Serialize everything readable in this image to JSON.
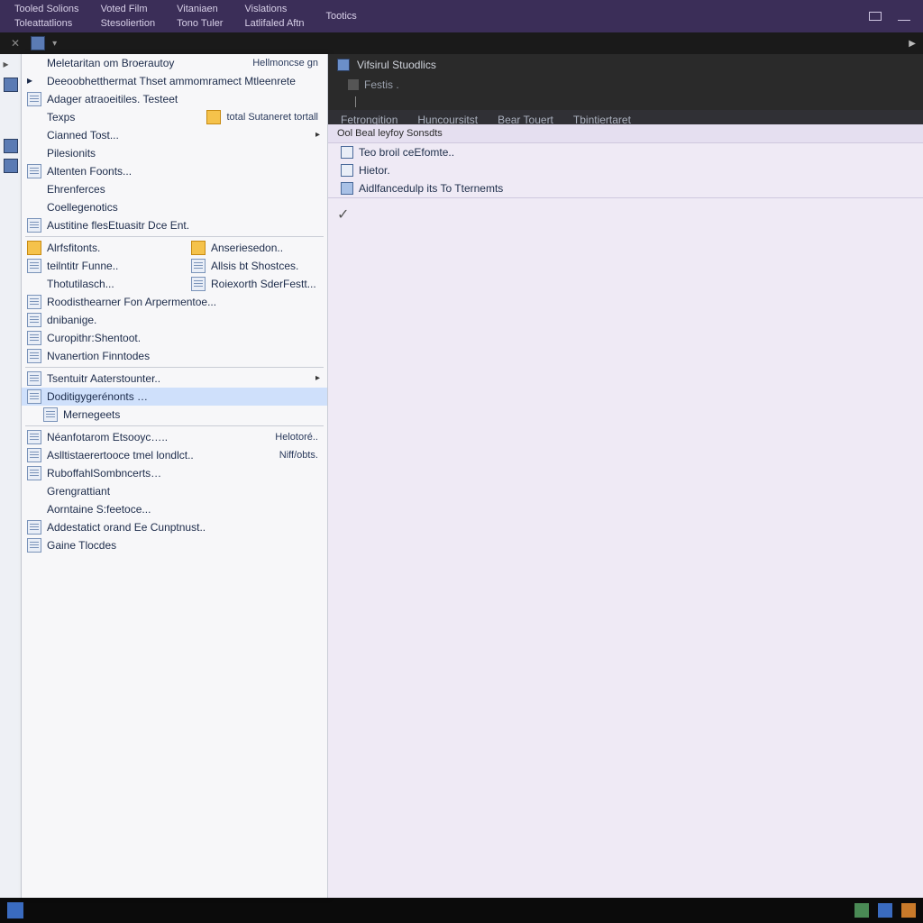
{
  "menubar": {
    "cols": [
      {
        "top": "Tooled Solions",
        "bot": "Toleattatlions"
      },
      {
        "top": "Voted Film",
        "bot": "Stesoliertion"
      },
      {
        "top": "Vitaniaen",
        "bot": "Tono Tuler"
      },
      {
        "top": "Vislations",
        "bot": "Latlifaled Aftn"
      },
      {
        "top": "",
        "bot": "Tootics"
      }
    ]
  },
  "toolstrip": {
    "x_symbol": "✕"
  },
  "panel": {
    "items": [
      {
        "icon": "none",
        "label": "Meletaritan om Broerautoy",
        "shortcut": "Hellmoncse gn"
      },
      {
        "icon": "play",
        "label": "Deeoobhetthermat Thset ammomramect Mtleenrete"
      },
      {
        "icon": "file",
        "label": "Adager atraoeitiles. Testeet"
      },
      {
        "icon": "select",
        "label": "Texps",
        "shortcut_icon": "folder",
        "shortcut": "total Sutaneret tortall"
      },
      {
        "icon": "none",
        "label": "Cianned Tost...",
        "has_submenu": true
      },
      {
        "icon": "none",
        "label": "Pilesionits"
      },
      {
        "icon": "file",
        "label": "Altenten Foonts..."
      },
      {
        "icon": "none",
        "label": "Ehrenferces"
      },
      {
        "icon": "none",
        "label": "Coellegenotics"
      },
      {
        "icon": "file",
        "label": "Austitine flesEtuasitr Dce Ent."
      },
      {
        "sep": true
      },
      {
        "two_col": true,
        "rows": [
          {
            "i1": "folder",
            "l1": "Alrfsfitonts.",
            "i2": "folder",
            "l2": "Anseriesedon.."
          },
          {
            "i1": "file",
            "l1": "teilntitr Funne..",
            "i2": "file",
            "l2": "Allsis bt Shostces."
          },
          {
            "i1": "none",
            "l1": "Thotutilasch...",
            "i2": "file",
            "l2": "Roiexorth SderFestt..."
          }
        ]
      },
      {
        "icon": "file",
        "label": "Roodisthearner Fon Arpermentoe..."
      },
      {
        "icon": "file",
        "label": "dnibanige."
      },
      {
        "icon": "file",
        "label": "Curopithr:Shentoot."
      },
      {
        "icon": "file",
        "label": "Nvanertion Finntodes"
      },
      {
        "sep": true
      },
      {
        "icon": "file",
        "label": "Tsentuitr Aaterstounter..",
        "has_submenu": true
      },
      {
        "icon": "file",
        "label": "Doditigygerénonts …",
        "selected": true
      },
      {
        "icon": "file",
        "label": "Mernegeets",
        "sub": true
      },
      {
        "sep": true
      },
      {
        "icon": "file",
        "label": "Néanfotarom Etsooyc…..",
        "shortcut": "Helotoré.."
      },
      {
        "icon": "file",
        "label": "Aslltistaerertooce tmel londlct..",
        "shortcut": "Niff/obts."
      },
      {
        "icon": "file",
        "label": "RuboffahlSombncerts…"
      },
      {
        "icon": "none",
        "label": "Grengrattiant"
      },
      {
        "icon": "none",
        "label": "Aorntaine S:feetoce..."
      },
      {
        "icon": "file",
        "label": "Addestatict orand Ee Cunptnust.."
      },
      {
        "icon": "file",
        "label": "Gaine Tlocdes"
      }
    ]
  },
  "content": {
    "title": "Vifsirul Stuodlics",
    "subtitle": "Festis .",
    "crumbs": [
      "Fetronqition",
      "Huncoursitst",
      "Bear Touert",
      "Tbintiertaret"
    ],
    "header": "Ool Beal leyfoy Sonsdts",
    "rows": [
      {
        "icon": "page",
        "label": "Teo broil ceEfomte.."
      },
      {
        "icon": "page",
        "label": "Hietor."
      },
      {
        "icon": "file",
        "label": "Aidlfancedulp its To Tternemts"
      }
    ],
    "check": "✓"
  }
}
